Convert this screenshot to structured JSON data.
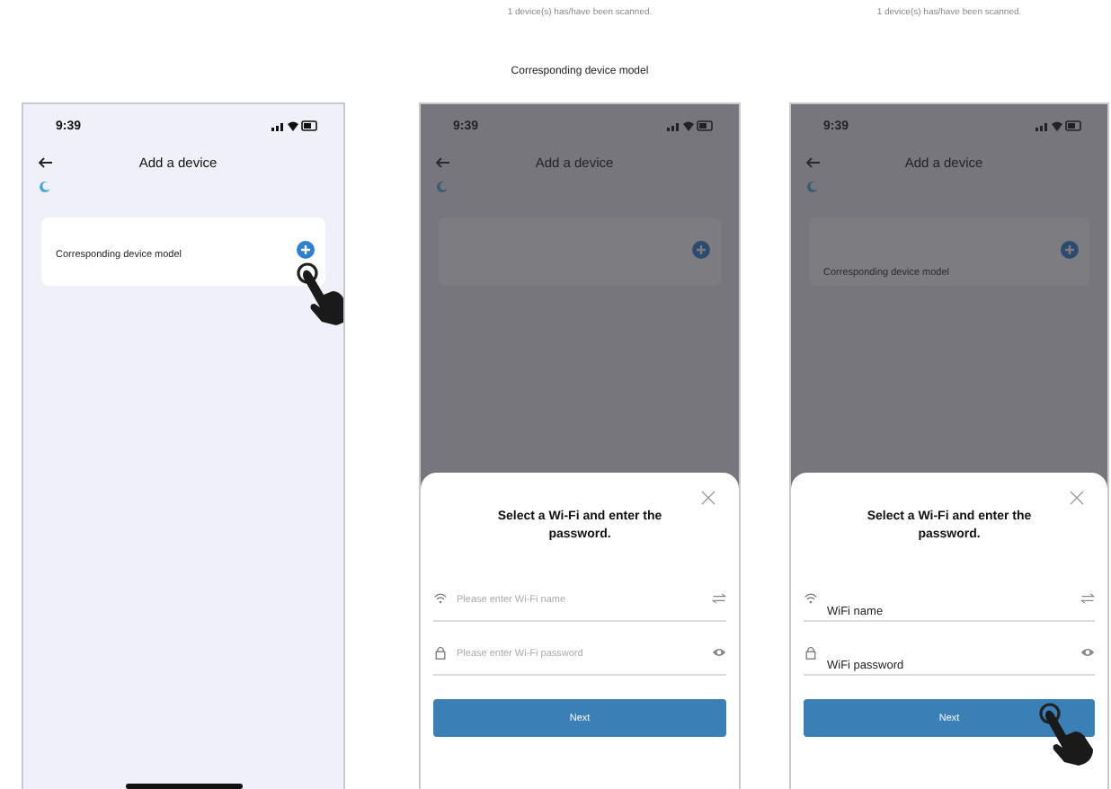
{
  "screens": [
    {
      "status_time": "9:39",
      "title": "Add a device",
      "card_text": "Corresponding device model",
      "card_tapped": true,
      "dimmed": false,
      "home_indicator": true
    },
    {
      "captions": [
        "1 device(s) has/have been scanned.",
        "Corresponding device model"
      ],
      "status_time": "9:39",
      "title": "Add a device",
      "card_tapped": false,
      "dimmed": true,
      "home_indicator": false,
      "sheet": {
        "title": "Select a Wi-Fi and enter the password.",
        "fields": [
          {
            "kind": "wifi",
            "placeholder": "Please enter Wi-Fi name"
          },
          {
            "kind": "password",
            "placeholder": "Please enter Wi-Fi password"
          }
        ],
        "button": "Next",
        "button_tapped": false
      }
    },
    {
      "captions": [
        "1 device(s) has/have been scanned."
      ],
      "status_time": "9:39",
      "title": "Add a device",
      "card_text": "Corresponding device model",
      "card_tapped": false,
      "dimmed": true,
      "home_indicator": false,
      "sheet": {
        "title": "Select a Wi-Fi and enter the password.",
        "fields": [
          {
            "kind": "wifi",
            "value": "WiFi name"
          },
          {
            "kind": "password",
            "value": "WiFi password"
          }
        ],
        "button": "Next",
        "button_tapped": true
      }
    }
  ]
}
